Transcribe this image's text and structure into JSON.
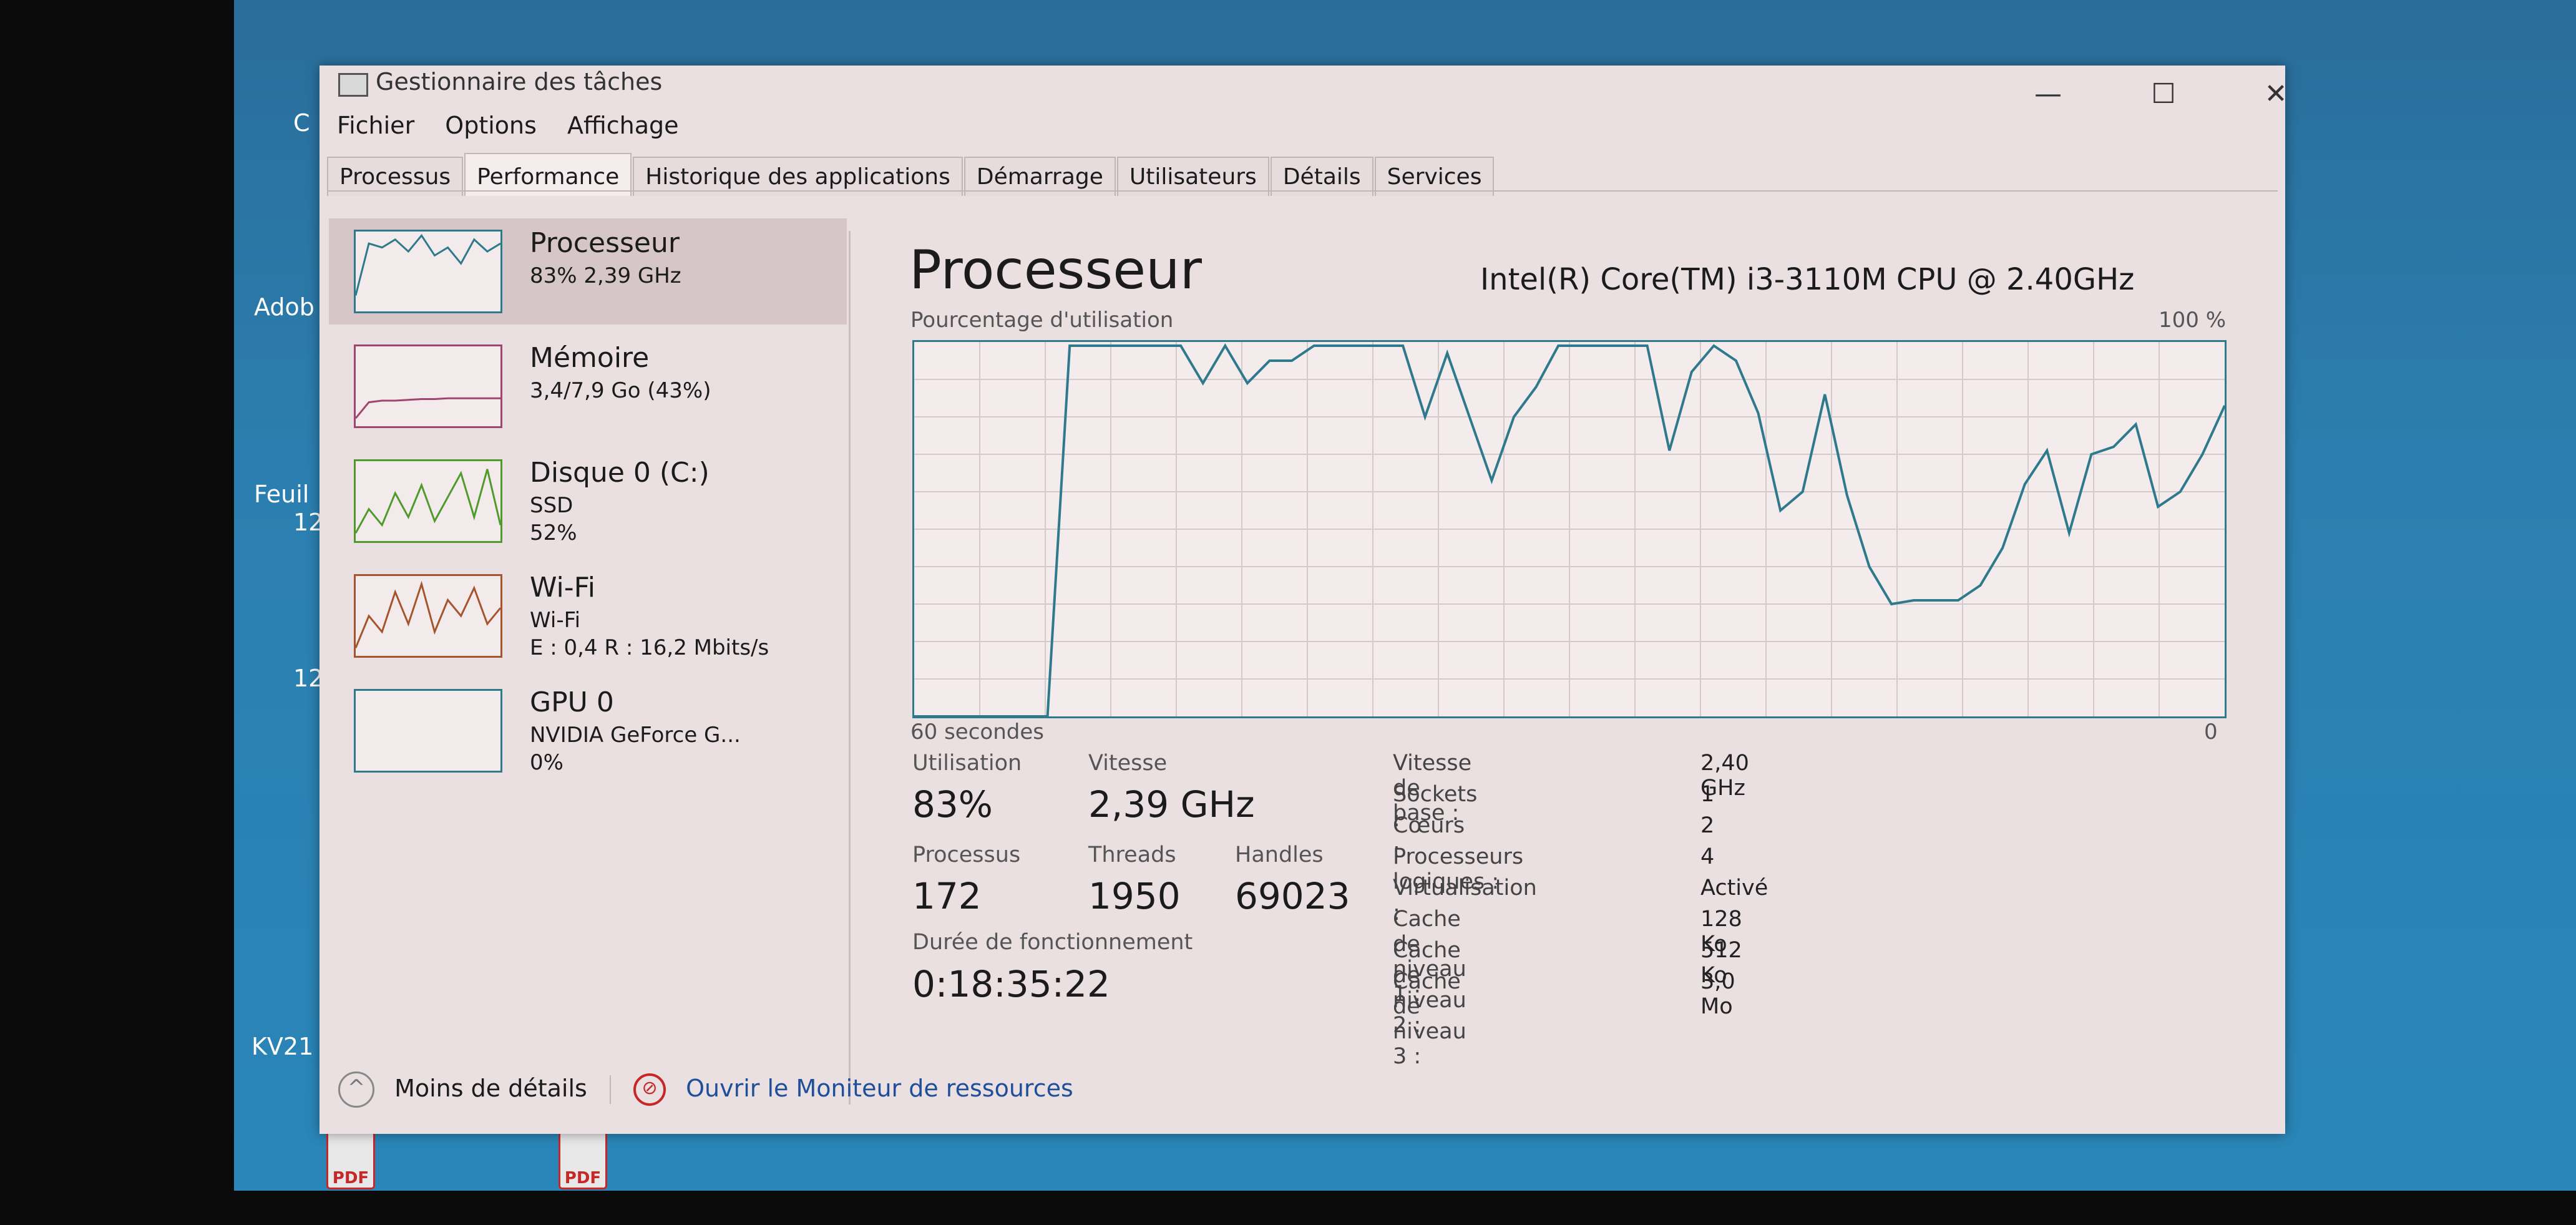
{
  "desktop": {
    "fragments": [
      "C",
      "Adob",
      "Feuil",
      "12",
      "12",
      "KV21"
    ],
    "pdf_label": "PDF"
  },
  "window": {
    "title": "Gestionnaire des tâches",
    "minimize": "—",
    "maximize": "☐",
    "close": "✕"
  },
  "menu": {
    "file": "Fichier",
    "options": "Options",
    "view": "Affichage"
  },
  "tabs": [
    {
      "label": "Processus"
    },
    {
      "label": "Performance"
    },
    {
      "label": "Historique des applications"
    },
    {
      "label": "Démarrage"
    },
    {
      "label": "Utilisateurs"
    },
    {
      "label": "Détails"
    },
    {
      "label": "Services"
    }
  ],
  "sidebar": {
    "items": [
      {
        "title": "Processeur",
        "line1": "83% 2,39 GHz",
        "line2": "",
        "line3": ""
      },
      {
        "title": "Mémoire",
        "line1": "3,4/7,9 Go (43%)",
        "line2": "",
        "line3": ""
      },
      {
        "title": "Disque 0 (C:)",
        "line1": "SSD",
        "line2": "52%",
        "line3": ""
      },
      {
        "title": "Wi-Fi",
        "line1": "Wi-Fi",
        "line2": "E : 0,4  R : 16,2 Mbits/s",
        "line3": ""
      },
      {
        "title": "GPU 0",
        "line1": "NVIDIA GeForce G...",
        "line2": "0%",
        "line3": ""
      }
    ]
  },
  "main": {
    "title": "Processeur",
    "cpu_name": "Intel(R) Core(TM) i3-3110M CPU @ 2.40GHz",
    "chart_top_left": "Pourcentage d'utilisation",
    "chart_top_right": "100 %",
    "chart_bottom_left": "60 secondes",
    "chart_bottom_right": "0"
  },
  "stats": {
    "utilisation_label": "Utilisation",
    "utilisation": "83%",
    "vitesse_label": "Vitesse",
    "vitesse": "2,39 GHz",
    "processus_label": "Processus",
    "processus": "172",
    "threads_label": "Threads",
    "threads": "1950",
    "handles_label": "Handles",
    "handles": "69023",
    "uptime_label": "Durée de fonctionnement",
    "uptime": "0:18:35:22"
  },
  "properties": [
    {
      "key": "Vitesse de base :",
      "value": "2,40 GHz"
    },
    {
      "key": "Sockets :",
      "value": "1"
    },
    {
      "key": "Cœurs :",
      "value": "2"
    },
    {
      "key": "Processeurs logiques :",
      "value": "4"
    },
    {
      "key": "Virtualisation :",
      "value": "Activé"
    },
    {
      "key": "Cache de niveau 1 :",
      "value": "128 Ko"
    },
    {
      "key": "Cache de niveau 2 :",
      "value": "512 Ko"
    },
    {
      "key": "Cache de niveau 3 :",
      "value": "3,0 Mo"
    }
  ],
  "footer": {
    "less_details": "Moins de détails",
    "resource_monitor": "Ouvrir le Moniteur de ressources"
  },
  "colors": {
    "cpu": "#2e7a8c",
    "memory": "#a04470",
    "disk": "#4f9a2a",
    "wifi": "#a5542d"
  },
  "chart_data": {
    "type": "line",
    "ylim": [
      0,
      100
    ],
    "series": [
      {
        "values": [
          0,
          0,
          0,
          0,
          0,
          0,
          0,
          99,
          99,
          99,
          99,
          99,
          99,
          89,
          99,
          89,
          95,
          95,
          99,
          99,
          99,
          99,
          99,
          80,
          97,
          80,
          63,
          80,
          88,
          99,
          99,
          99,
          99,
          99,
          71,
          92,
          99,
          95,
          81,
          55,
          60,
          86,
          59,
          40,
          30,
          31,
          31,
          31,
          35,
          45,
          62,
          71,
          49,
          70,
          72,
          78,
          56,
          60,
          70,
          83
        ]
      }
    ]
  },
  "sparklines": {
    "cpu": [
      20,
      85,
      80,
      90,
      75,
      95,
      70,
      80,
      60,
      90,
      75,
      85
    ],
    "memory": [
      10,
      30,
      32,
      32,
      33,
      34,
      34,
      35,
      35,
      35,
      35,
      35
    ],
    "disk": [
      10,
      40,
      20,
      60,
      30,
      70,
      25,
      55,
      85,
      30,
      90,
      20
    ],
    "wifi": [
      10,
      50,
      30,
      80,
      40,
      90,
      30,
      70,
      50,
      85,
      40,
      60
    ]
  }
}
